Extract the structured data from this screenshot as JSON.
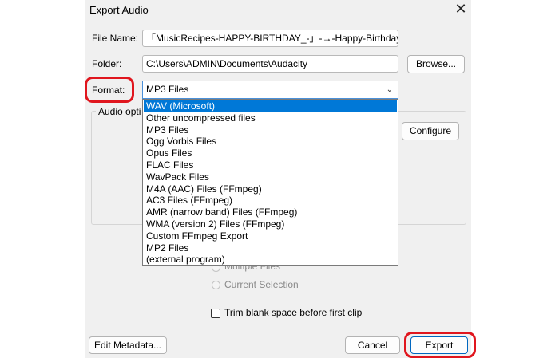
{
  "window": {
    "title": "Export Audio",
    "close_glyph": "✕"
  },
  "file_name": {
    "label": "File Name:",
    "value": "「MusicRecipes-HAPPY-BIRTHDAY_-」-→-Happy-Birthday-to"
  },
  "folder": {
    "label": "Folder:",
    "value": "C:\\Users\\ADMIN\\Documents\\Audacity",
    "browse_label": "Browse..."
  },
  "format": {
    "label": "Format:",
    "selected": "MP3 Files",
    "options": [
      "WAV (Microsoft)",
      "Other uncompressed files",
      "MP3 Files",
      "Ogg Vorbis Files",
      "Opus Files",
      "FLAC Files",
      "WavPack Files",
      "M4A (AAC) Files (FFmpeg)",
      "AC3 Files (FFmpeg)",
      "AMR (narrow band) Files (FFmpeg)",
      "WMA (version 2) Files (FFmpeg)",
      "Custom FFmpeg Export",
      "MP2 Files",
      "(external program)"
    ],
    "highlighted_index": 0
  },
  "audio_options": {
    "label": "Audio opti",
    "configure_label": "Configure"
  },
  "export_range": {
    "multiple_files": "Multiple Files",
    "current_selection": "Current Selection"
  },
  "trim": {
    "label": "Trim blank space before first clip",
    "checked": false
  },
  "footer": {
    "edit_metadata_label": "Edit Metadata...",
    "cancel_label": "Cancel",
    "export_label": "Export"
  },
  "colors": {
    "highlight": "#0078d7",
    "annotation_ring": "#e0161e",
    "dialog_bg": "#f0f0f0"
  }
}
